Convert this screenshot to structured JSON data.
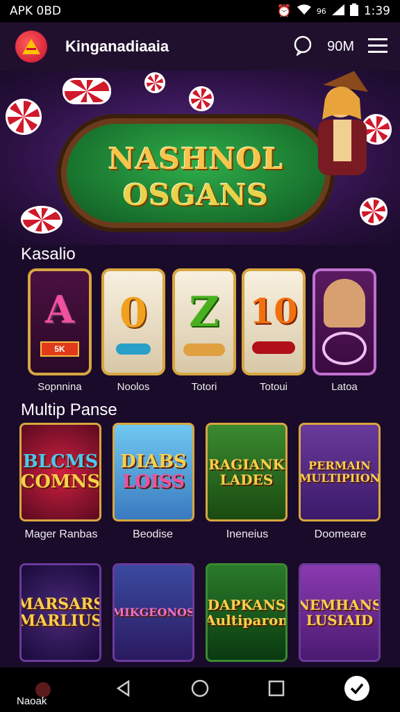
{
  "status": {
    "left": "APK 0BD",
    "signal_text": "96",
    "time": "1:39"
  },
  "appbar": {
    "title": "Kinganadiaaia",
    "coin_text": "90M"
  },
  "banner": {
    "line1": "NASHNOL",
    "line2": "OSGANS"
  },
  "sections": {
    "first_title": "Kasalio",
    "second_title": "Multip Panse"
  },
  "reels": [
    {
      "symbol": "A",
      "sub": "5K",
      "caption": "Sopnnina"
    },
    {
      "symbol": "0",
      "sub": "",
      "caption": "Noolos"
    },
    {
      "symbol": "Z",
      "sub": "",
      "caption": "Totori"
    },
    {
      "symbol": "10",
      "sub": "",
      "caption": "Totoui"
    },
    {
      "symbol": "",
      "sub": "",
      "caption": "Latoa"
    }
  ],
  "tiles_row1": [
    {
      "line1": "BLCMS",
      "line2": "COMNS",
      "caption": "Mager Ranbas"
    },
    {
      "line1": "DIABS",
      "line2": "LOISS",
      "caption": "Beodise"
    },
    {
      "line1": "RAGIANK",
      "line2": "LADES",
      "caption": "Ineneius"
    },
    {
      "line1": "PERMAIN",
      "line2": "MULTIPIION",
      "caption": "Doomeare"
    }
  ],
  "tiles_row2": [
    {
      "line1": "MARSARS",
      "line2": "MARLIUS"
    },
    {
      "line1": "MIKGEONOS",
      "line2": ""
    },
    {
      "line1": "DAPKANS",
      "line2": "Aultiparon"
    },
    {
      "line1": "NEMHANS",
      "line2": "LUSIAID"
    }
  ],
  "nav": {
    "label": "Naoak"
  },
  "colors": {
    "accent": "#d8a640",
    "bg": "#1a0b2a",
    "logo": "#c8102e"
  }
}
